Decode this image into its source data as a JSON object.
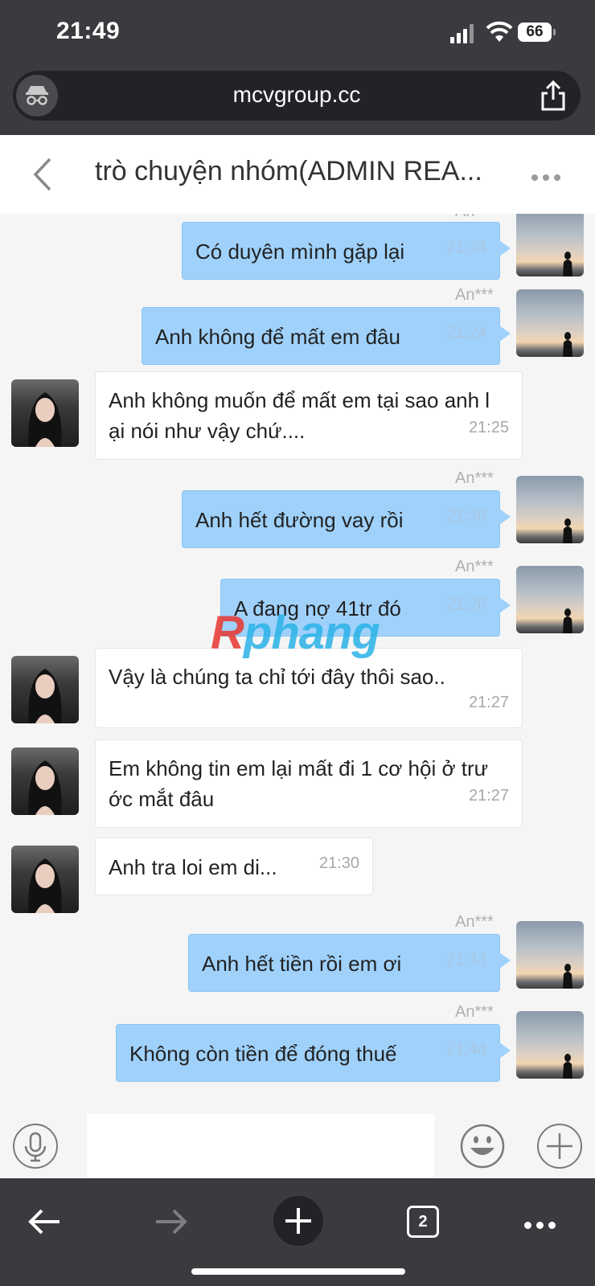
{
  "status_bar": {
    "time": "21:49",
    "battery": "66"
  },
  "browser": {
    "url": "mcvgroup.cc",
    "tab_count": "2"
  },
  "chat": {
    "title": "trò chuyện nhóm(ADMIN REA...",
    "messages": [
      {
        "dir": "out",
        "sender": "An***",
        "text": "Có duyên mình gặp lại",
        "time": "21:24"
      },
      {
        "dir": "out",
        "sender": "An***",
        "text": "Anh không để mất em đâu",
        "time": "21:24"
      },
      {
        "dir": "in",
        "text_line1": "Anh không muốn để mất em tại sao anh l",
        "text_line2": "ại nói như vậy chứ....",
        "time": "21:25"
      },
      {
        "dir": "out",
        "sender": "An***",
        "text": "Anh hết đường vay rồi",
        "time": "21:26"
      },
      {
        "dir": "out",
        "sender": "An***",
        "text": "A đang nợ 41tr đó",
        "time": "21:26"
      },
      {
        "dir": "in",
        "text": "Vậy là chúng ta chỉ tới đây thôi sao..",
        "time": "21:27"
      },
      {
        "dir": "in",
        "text_line1": "Em không tin em lại mất đi 1 cơ hội ở trư",
        "text_line2": "ớc mắt đâu",
        "time": "21:27"
      },
      {
        "dir": "in",
        "text": "Anh tra loi em di...",
        "time": "21:30"
      },
      {
        "dir": "out",
        "sender": "An***",
        "text": "Anh hết tiền rồi em ơi",
        "time": "21:43"
      },
      {
        "dir": "out",
        "sender": "An***",
        "text": "Không còn tiền để đóng thuế",
        "time": "21:44"
      }
    ]
  },
  "watermark": {
    "part1": "R",
    "part2": "phang"
  },
  "icons": [
    "incognito-icon",
    "share-icon",
    "back-chevron-icon",
    "more-icon",
    "microphone-icon",
    "emoji-icon",
    "plus-icon",
    "arrow-left-icon",
    "arrow-right-icon",
    "tabs-icon"
  ],
  "colors": {
    "out_bubble": "#9fd1fb",
    "in_bubble": "#ffffff",
    "chrome": "#3a3b3e"
  }
}
